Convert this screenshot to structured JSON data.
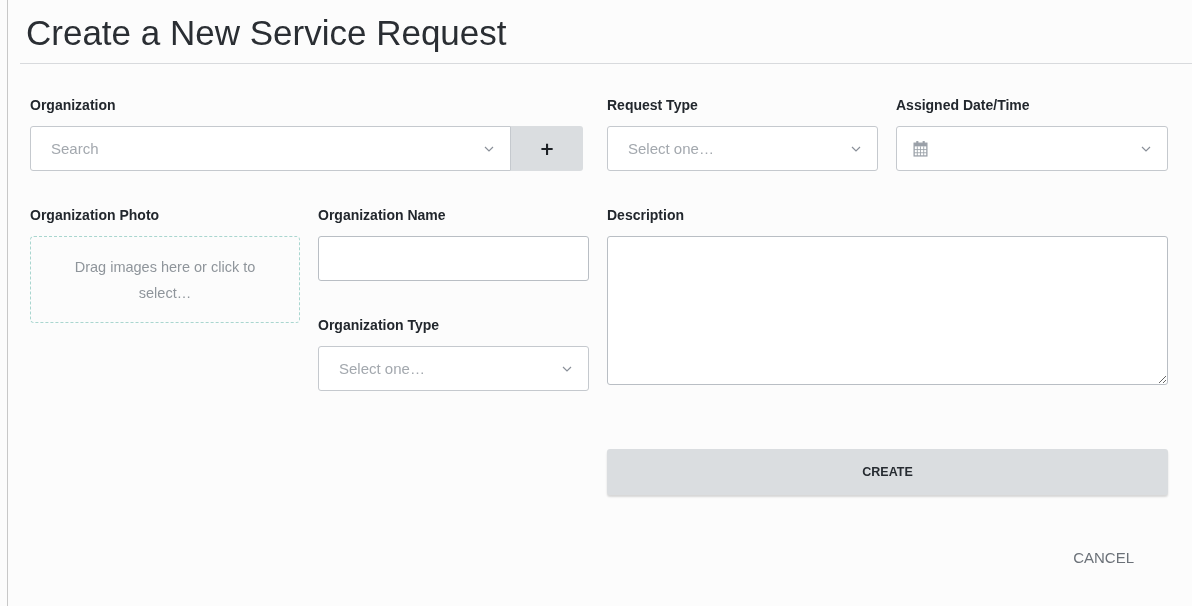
{
  "title": "Create a New Service Request",
  "organization": {
    "label": "Organization",
    "placeholder": "Search",
    "add_button": "+"
  },
  "request_type": {
    "label": "Request Type",
    "placeholder": "Select one…"
  },
  "assigned_date_time": {
    "label": "Assigned Date/Time"
  },
  "organization_photo": {
    "label": "Organization Photo",
    "hint": "Drag images here or click to select…"
  },
  "organization_name": {
    "label": "Organization Name"
  },
  "organization_type": {
    "label": "Organization Type",
    "placeholder": "Select one…"
  },
  "description": {
    "label": "Description"
  },
  "buttons": {
    "create": "CREATE",
    "cancel": "CANCEL"
  }
}
